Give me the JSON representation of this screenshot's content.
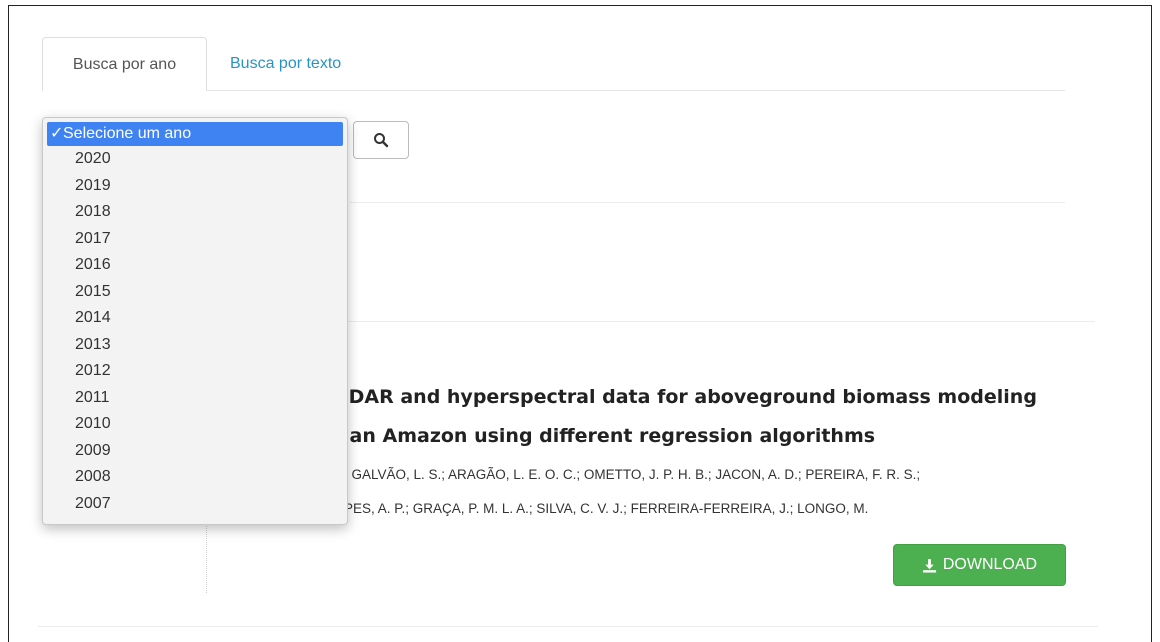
{
  "tabs": [
    {
      "label": "Busca por ano",
      "active": true
    },
    {
      "label": "Busca por texto",
      "active": false
    }
  ],
  "year_select": {
    "selected": "Selecione um ano",
    "check_glyph": "✓",
    "options": [
      "2020",
      "2019",
      "2018",
      "2017",
      "2016",
      "2015",
      "2014",
      "2013",
      "2012",
      "2011",
      "2010",
      "2009",
      "2008",
      "2007"
    ]
  },
  "search_button": {
    "icon": "search-icon"
  },
  "article": {
    "title_line1": "LiDAR and hyperspectral data for aboveground biomass modeling",
    "title_line2": "ilian Amazon using different regression algorithms",
    "authors_line1": "; GALVÃO, L. S.; ARAGÃO, L. E. O. C.; OMETTO, J. P. H. B.; JACON, A. D.; PEREIRA, F. R. S.;",
    "authors_line2": "PES, A. P.; GRAÇA, P. M. L. A.; SILVA, C. V. J.; FERREIRA-FERREIRA, J.; LONGO, M."
  },
  "download_button": {
    "label": "DOWNLOAD",
    "icon": "download-icon",
    "color": "#4caf50"
  },
  "colors": {
    "link": "#2a93c6",
    "highlight": "#3f82f2"
  }
}
